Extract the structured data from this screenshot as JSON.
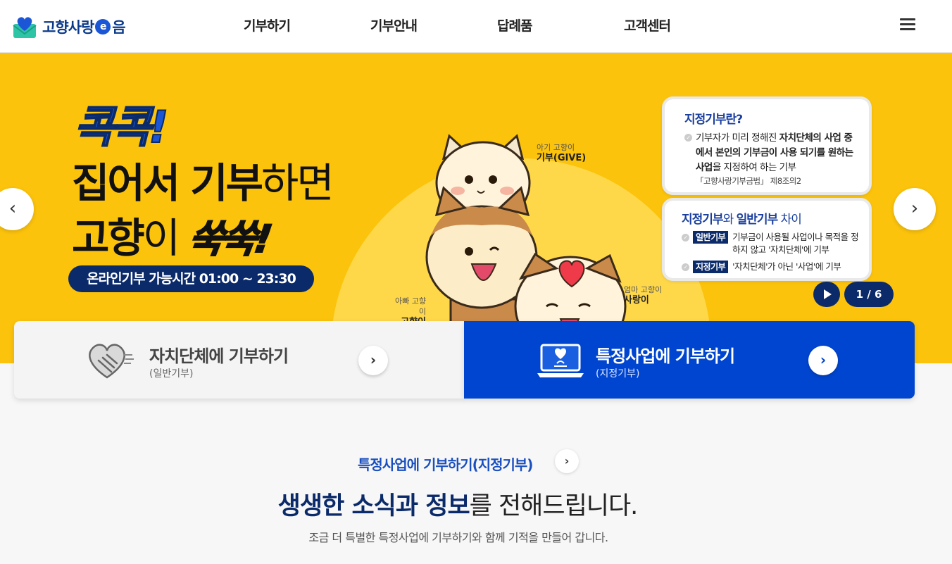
{
  "header": {
    "logo_text_1": "고향사랑",
    "logo_e": "e",
    "logo_text_2": "음",
    "nav": [
      {
        "label": "기부하기"
      },
      {
        "label": "기부안내"
      },
      {
        "label": "답례품"
      },
      {
        "label": "고객센터"
      }
    ],
    "menu_icon": "hamburger-icon"
  },
  "hero": {
    "line0": "콕콕!",
    "line1_bold": "집어서 기부",
    "line1_rest": "하면",
    "line2_bold": "고향",
    "line2_mid": "이 ",
    "line2_suk": "쑥쑥!",
    "pill": "온라인기부 가능시간 01:00 ~ 23:30",
    "characters": [
      {
        "role": "아기 고향이",
        "name": "기부(GIVE)"
      },
      {
        "role": "아빠 고향이",
        "name": "고향이"
      },
      {
        "role": "엄마 고향이",
        "name": "사랑이"
      }
    ],
    "info1": {
      "title": "지정기부란?",
      "body_a": "기부자가 미리 정해진 ",
      "body_b": "자치단체의 사업 중에서 본인의 기부금이 사용 되기를 원하는 사업",
      "body_c": "을 지정하여 하는 기부",
      "ref": "「고향사랑기부금법」 제8조의2"
    },
    "info2": {
      "title_a": "지정기부",
      "title_b": "와 ",
      "title_c": "일반기부",
      "title_d": " 차이",
      "row1_tag": "일반기부",
      "row1_text": "기부금이 사용될 사업이나 목적을 정하지 않고 '자치단체'에 기부",
      "row2_tag": "지정기부",
      "row2_text": "'자치단체'가 아닌 '사업'에 기부"
    },
    "prev_arrow": "‹",
    "next_arrow": "›",
    "page_counter": "1 / 6"
  },
  "cards": {
    "general": {
      "title": "자치단체에 기부하기",
      "sub": "(일반기부)"
    },
    "designated": {
      "title": "특정사업에 기부하기",
      "sub": "(지정기부)"
    }
  },
  "section": {
    "link": "특정사업에 기부하기(지정기부)",
    "title_bold": "생생한 소식과 정보",
    "title_rest": "를 전해드립니다.",
    "subtitle": "조금 더 특별한 특정사업에 기부하기와 함께 기적을 만들어 갑니다."
  },
  "colors": {
    "hero_bg": "#fcc30c",
    "brand_blue": "#0045d0",
    "navy": "#0b2a6a"
  }
}
